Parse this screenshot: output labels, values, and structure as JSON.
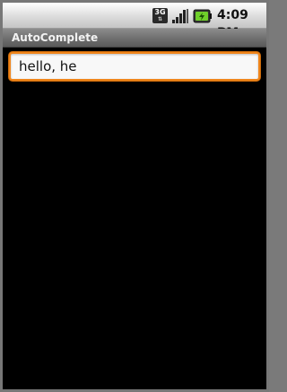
{
  "status_bar": {
    "network_label": "3G",
    "signal_icon": "signal-strength-icon",
    "battery_icon": "battery-charging-icon",
    "time": "4:09",
    "am_pm": "PM"
  },
  "app": {
    "title": "AutoComplete"
  },
  "autocomplete": {
    "value": "hello, he",
    "focus_color": "#f0851a"
  }
}
